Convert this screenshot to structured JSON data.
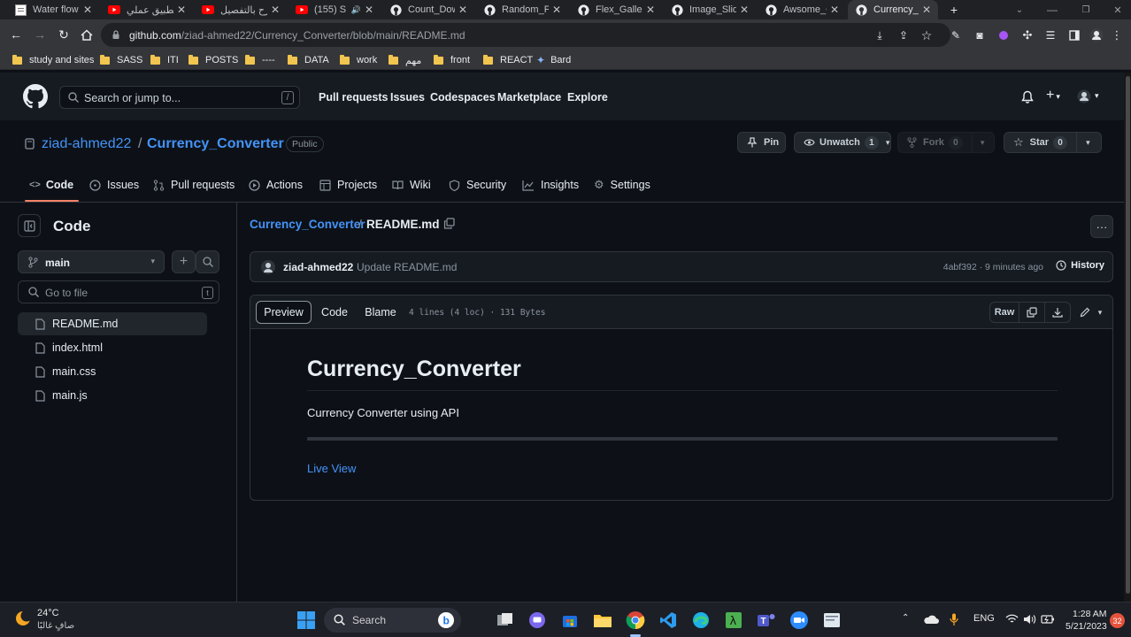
{
  "browser": {
    "tabs": [
      {
        "title": "Water flow",
        "icon": "page-icon"
      },
      {
        "title": "تطبيق عملي",
        "icon": "youtube-icon"
      },
      {
        "title": "شرح بالتفصيل",
        "icon": "youtube-icon"
      },
      {
        "title": "(155) S",
        "icon": "youtube-icon"
      },
      {
        "title": "Count_Dow",
        "icon": "github-icon"
      },
      {
        "title": "Random_Pa",
        "icon": "github-icon"
      },
      {
        "title": "Flex_Gallery",
        "icon": "github-icon"
      },
      {
        "title": "Image_Slide",
        "icon": "github-icon"
      },
      {
        "title": "Awsome_G",
        "icon": "github-icon"
      },
      {
        "title": "Currency_C",
        "icon": "github-icon"
      }
    ],
    "url_host": "github.com",
    "url_path": "/ziad-ahmed22/Currency_Converter/blob/main/README.md",
    "bookmarks": [
      "study and sites",
      "SASS",
      "ITI",
      "POSTS",
      "----",
      "DATA",
      "work",
      "مهم",
      "front",
      "REACT",
      "Bard"
    ]
  },
  "github": {
    "search_placeholder": "Search or jump to...",
    "search_key": "/",
    "nav": [
      "Pull requests",
      "Issues",
      "Codespaces",
      "Marketplace",
      "Explore"
    ],
    "repo": {
      "owner": "ziad-ahmed22",
      "separator": "/",
      "name": "Currency_Converter",
      "visibility": "Public",
      "pin_label": "Pin",
      "unwatch_label": "Unwatch",
      "watch_count": "1",
      "fork_label": "Fork",
      "fork_count": "0",
      "star_label": "Star",
      "star_count": "0"
    },
    "repo_tabs": [
      "Code",
      "Issues",
      "Pull requests",
      "Actions",
      "Projects",
      "Wiki",
      "Security",
      "Insights",
      "Settings"
    ],
    "sidebar": {
      "title": "Code",
      "branch": "main",
      "goto_placeholder": "Go to file",
      "goto_key": "t",
      "files": [
        "README.md",
        "index.html",
        "main.css",
        "main.js"
      ]
    },
    "breadcrumb": {
      "repo": "Currency_Converter",
      "sep": "/",
      "file": "README.md"
    },
    "commit": {
      "author": "ziad-ahmed22",
      "message": "Update README.md",
      "meta": "4abf392 · 9 minutes ago",
      "history": "History"
    },
    "file_view": {
      "tabs": [
        "Preview",
        "Code",
        "Blame"
      ],
      "info": "4 lines (4 loc) · 131 Bytes",
      "raw": "Raw"
    },
    "readme": {
      "title": "Currency_Converter",
      "description": "Currency Converter using API",
      "link": "Live View"
    }
  },
  "taskbar": {
    "weather_temp": "24°C",
    "weather_desc": "صافٍ غالبًا",
    "search_label": "Search",
    "lang": "ENG",
    "time": "1:28 AM",
    "date": "5/21/2023",
    "notification_count": "32"
  },
  "colors": {
    "accent": "#4493f8",
    "tab_underline": "#f78166",
    "background": "#0d1117"
  }
}
